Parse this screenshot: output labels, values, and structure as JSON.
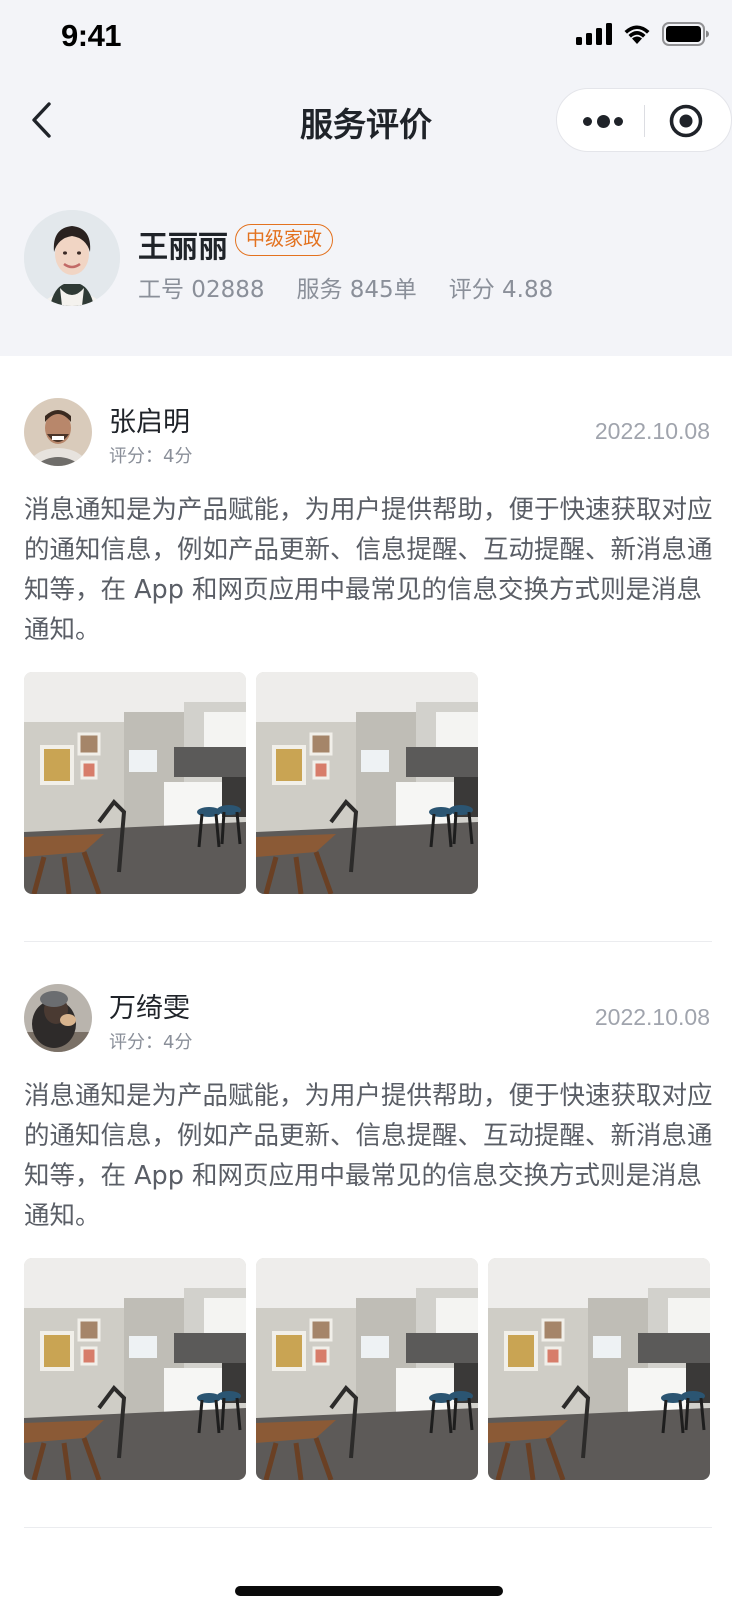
{
  "status_bar": {
    "time": "9:41"
  },
  "nav": {
    "title": "服务评价"
  },
  "worker": {
    "name": "王丽丽",
    "badge": "中级家政",
    "id_text": "工号 02888",
    "service_text": "服务 845单",
    "rating_text": "评分 4.88"
  },
  "reviews": [
    {
      "name": "张启明",
      "score": "评分：4分",
      "date": "2022.10.08",
      "text": "消息通知是为产品赋能，为用户提供帮助，便于快速获取对应的通知信息，例如产品更新、信息提醒、互动提醒、新消息通知等，在 App 和网页应用中最常见的信息交换方式则是消息通知。",
      "photo_count": 2
    },
    {
      "name": "万绮雯",
      "score": "评分：4分",
      "date": "2022.10.08",
      "text": "消息通知是为产品赋能，为用户提供帮助，便于快速获取对应的通知信息，例如产品更新、信息提醒、互动提醒、新消息通知等，在 App 和网页应用中最常见的信息交换方式则是消息通知。",
      "photo_count": 3
    }
  ],
  "colors": {
    "accent": "#e3721f",
    "header_bg": "#f3f4f8",
    "muted": "#8a8f99"
  }
}
